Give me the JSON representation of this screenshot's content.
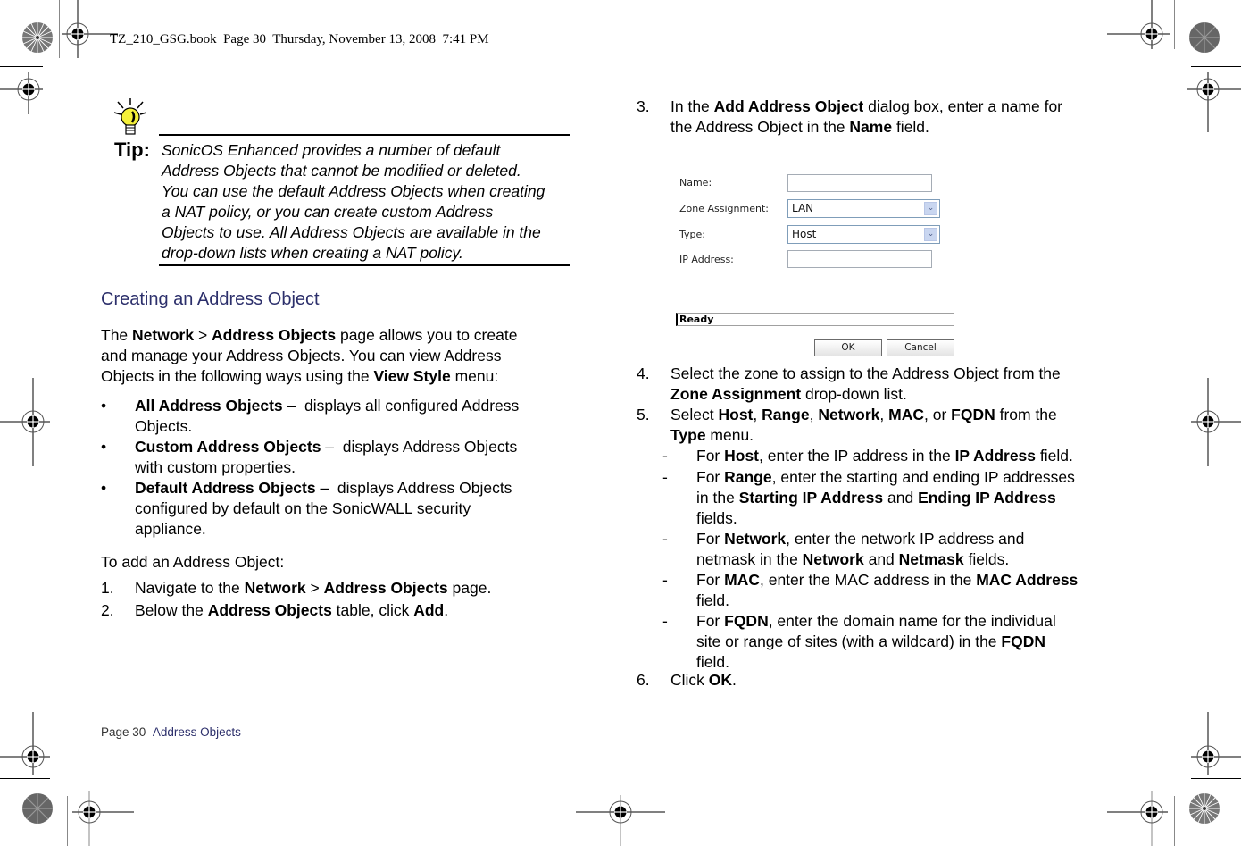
{
  "header": {
    "slug": "TZ_210_GSG.book  Page 30  Thursday, November 13, 2008  7:41 PM"
  },
  "tip": {
    "label": "Tip:",
    "icon": "lightbulb-icon",
    "text": "SonicOS Enhanced provides a number of default Address Objects that cannot be modified or deleted. You can use the default Address Objects when creating a NAT policy, or you can create custom Address Objects to use. All Address Objects are available in the drop-down lists when creating a NAT policy.",
    "lines": [
      "SonicOS Enhanced provides a number of default",
      "Address Objects that cannot be modified or deleted.",
      "You can use the default Address Objects when creating",
      "a NAT policy, or you can create custom Address",
      "Objects to use. All Address Objects are available in the",
      "drop-down lists when creating a NAT policy."
    ]
  },
  "section": {
    "heading": "Creating an Address Object",
    "intro": {
      "p1": "The ",
      "b1": "Network",
      "p2": " > ",
      "b2": "Address Objects",
      "p3": " page allows you to create",
      "line2": "and manage your Address Objects. You can view Address",
      "p4": "Objects in the following ways using the ",
      "b3": "View Style",
      "p5": " menu:"
    },
    "bullets": [
      {
        "bold": "All Address Objects",
        "rest": " –  displays all configured Address",
        "cont": [
          "Objects."
        ]
      },
      {
        "bold": "Custom Address Objects",
        "rest": " –  displays Address Objects",
        "cont": [
          "with custom properties."
        ]
      },
      {
        "bold": "Default Address Objects",
        "rest": " –  displays Address Objects",
        "cont": [
          "configured by default on the SonicWALL security",
          "appliance."
        ]
      }
    ],
    "bullet_glyph": "•",
    "to_add": "To add an Address Object:"
  },
  "steps": {
    "s1": {
      "num": "1.",
      "a": "Navigate to the ",
      "b1": "Network",
      "c": " > ",
      "b2": "Address Objects",
      "d": " page."
    },
    "s2": {
      "num": "2.",
      "a": "Below the ",
      "b1": "Address Objects",
      "c": " table, click ",
      "b2": "Add",
      "d": "."
    },
    "s3": {
      "num": "3.",
      "a": "In the ",
      "b1": "Add Address Object",
      "c": " dialog box, enter a name for",
      "line2a": "the Address Object in the ",
      "b2": "Name",
      "d": " field."
    },
    "s4": {
      "num": "4.",
      "a": "Select the zone to assign to the Address Object from the",
      "b1": "Zone Assignment",
      "c": " drop-down list."
    },
    "s5": {
      "num": "5.",
      "a": "Select ",
      "host": "Host",
      "comma1": ", ",
      "range": "Range",
      "comma2": ", ",
      "network": "Network",
      "comma3": ", ",
      "mac": "MAC",
      "or": ", or ",
      "fqdn": "FQDN",
      "from": " from the",
      "type": "Type",
      "menu": " menu.",
      "dash": "-",
      "subs": {
        "host": {
          "a": "For ",
          "b1": "Host",
          "c": ", enter the IP address in the ",
          "b2": "IP Address",
          "d": " field."
        },
        "range": {
          "a": "For ",
          "b1": "Range",
          "c": ", enter the starting and ending IP addresses",
          "e": "in the ",
          "b2": "Starting IP Address",
          "f": " and ",
          "b3": "Ending IP Address",
          "g": "fields."
        },
        "network": {
          "a": "For ",
          "b1": "Network",
          "c": ", enter the network IP address and",
          "e": "netmask in the ",
          "b2": "Network",
          "f": " and ",
          "b3": "Netmask",
          "g": " fields."
        },
        "mac": {
          "a": "For ",
          "b1": "MAC",
          "c": ", enter the MAC address in the ",
          "b2": "MAC Address",
          "g": "field."
        },
        "fqdn": {
          "a": "For ",
          "b1": "FQDN",
          "c": ", enter the domain name for the individual",
          "e": "site or range of sites (with a wildcard) in the ",
          "b2": "FQDN",
          "g": "field."
        }
      }
    },
    "s6": {
      "num": "6.",
      "a": "Click ",
      "b1": "OK",
      "d": "."
    }
  },
  "dialog": {
    "name_label": "Name:",
    "name_value": "",
    "zone_label": "Zone Assignment:",
    "zone_value": "LAN",
    "type_label": "Type:",
    "type_value": "Host",
    "ip_label": "IP Address:",
    "ip_value": "",
    "status": "Ready",
    "ok_label": "OK",
    "cancel_label": "Cancel",
    "arrow_glyph": "⌄"
  },
  "footer": {
    "page": "Page 30",
    "section": "Address Objects"
  },
  "colors": {
    "heading": "#2c2f6b",
    "tip_bulb": "#f4f03a"
  }
}
